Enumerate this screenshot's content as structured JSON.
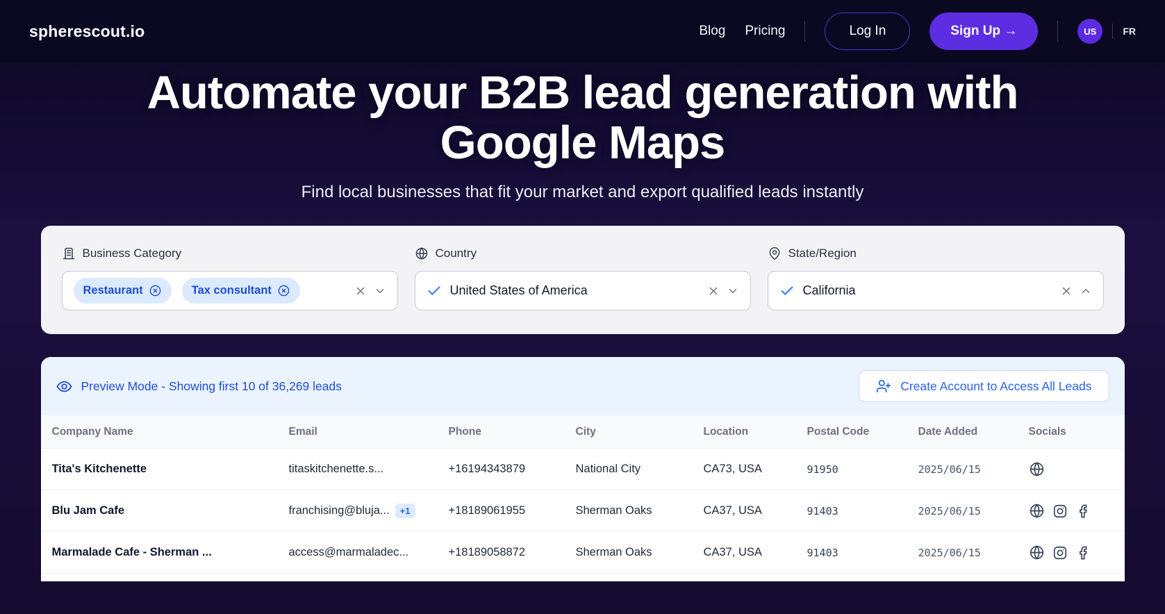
{
  "brand": {
    "logo": "spherescout.io"
  },
  "nav": {
    "blog": "Blog",
    "pricing": "Pricing",
    "login": "Log In",
    "signup": "Sign Up →",
    "lang_active": "US",
    "lang_alt": "FR"
  },
  "hero": {
    "title_line1": "Automate your B2B lead generation with",
    "title_line2": "Google Maps",
    "subtitle": "Find local businesses that fit your market and export qualified leads instantly"
  },
  "filters": {
    "category": {
      "label": "Business Category",
      "tags": {
        "0": "Restaurant",
        "1": "Tax consultant"
      }
    },
    "country": {
      "label": "Country",
      "value": "United States of America"
    },
    "state": {
      "label": "State/Region",
      "value": "California"
    }
  },
  "preview": {
    "banner": "Preview Mode - Showing first 10 of 36,269 leads",
    "cta": "Create Account to Access All Leads"
  },
  "table": {
    "headers": {
      "company": "Company Name",
      "email": "Email",
      "phone": "Phone",
      "city": "City",
      "location": "Location",
      "postal": "Postal Code",
      "date": "Date Added",
      "socials": "Socials"
    },
    "rows": [
      {
        "company": "Tita's Kitchenette",
        "email": "titaskitchenette.s...",
        "phone": "+16194343879",
        "city": "National City",
        "location": "CA73, USA",
        "postal": "91950",
        "date": "2025/06/15",
        "socials": "website"
      },
      {
        "company": "Blu Jam Cafe",
        "email": "franchising@bluja...",
        "email_extra": "+1",
        "phone": "+18189061955",
        "city": "Sherman Oaks",
        "location": "CA37, USA",
        "postal": "91403",
        "date": "2025/06/15",
        "socials": "website, instagram, facebook"
      },
      {
        "company": "Marmalade Cafe - Sherman ...",
        "email": "access@marmaladec...",
        "phone": "+18189058872",
        "city": "Sherman Oaks",
        "location": "CA37, USA",
        "postal": "91403",
        "date": "2025/06/15",
        "socials": "website, instagram, facebook"
      }
    ]
  },
  "colors": {
    "accent_purple": "#5c2de1",
    "nav_bg": "#0b0822",
    "link_blue": "#1d4ed8",
    "cta_blue": "#2563eb",
    "check_blue": "#3b82f6",
    "tag_bg": "#dbeafe",
    "tag_text": "#1d4ed8",
    "preview_bar_bg": "#ebf3fe"
  }
}
